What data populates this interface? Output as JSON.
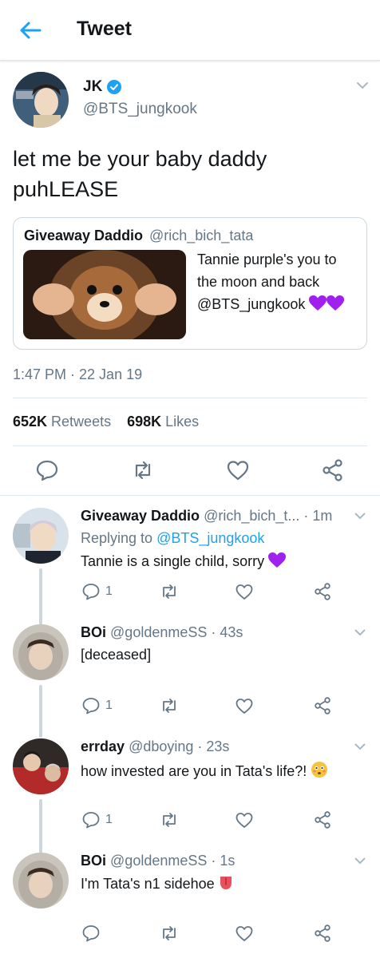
{
  "header": {
    "title": "Tweet",
    "back_icon": "back-arrow-icon"
  },
  "tweet": {
    "author_name": "JK",
    "author_handle": "@BTS_jungkook",
    "verified": true,
    "text_line1": "let me be your baby daddy",
    "text_line2": "puhLEASE",
    "timestamp": "1:47 PM · 22 Jan 19",
    "retweets_count": "652K",
    "retweets_label": "Retweets",
    "likes_count": "698K",
    "likes_label": "Likes"
  },
  "quote": {
    "name": "Giveaway Daddio",
    "handle": "@rich_bich_tata",
    "text_line1": "Tannie purple's you to",
    "text_line2": "the moon and back",
    "text_line3": "@BTS_jungkook"
  },
  "replies": [
    {
      "name": "Giveaway Daddio",
      "handle_time": "@rich_bich_t... · 1m",
      "replying_prefix": "Replying to ",
      "replying_to": "@BTS_jungkook",
      "text": "Tannie is a single child, sorry",
      "reply_count": "1"
    },
    {
      "name": "BOi",
      "handle_time": "@goldenmeSS · 43s",
      "text": "[deceased]",
      "reply_count": "1"
    },
    {
      "name": "errday",
      "handle_time": "@dboying · 23s",
      "text": "how invested are you in Tata's life?!",
      "reply_count": "1"
    },
    {
      "name": "BOi",
      "handle_time": "@goldenmeSS · 1s",
      "text": "I'm Tata's n1 sidehoe",
      "reply_count": ""
    }
  ],
  "colors": {
    "accent": "#1da1f2",
    "muted": "#657786",
    "text": "#14171a",
    "border": "#e1e8ed",
    "purple_heart": "#a020f0"
  }
}
